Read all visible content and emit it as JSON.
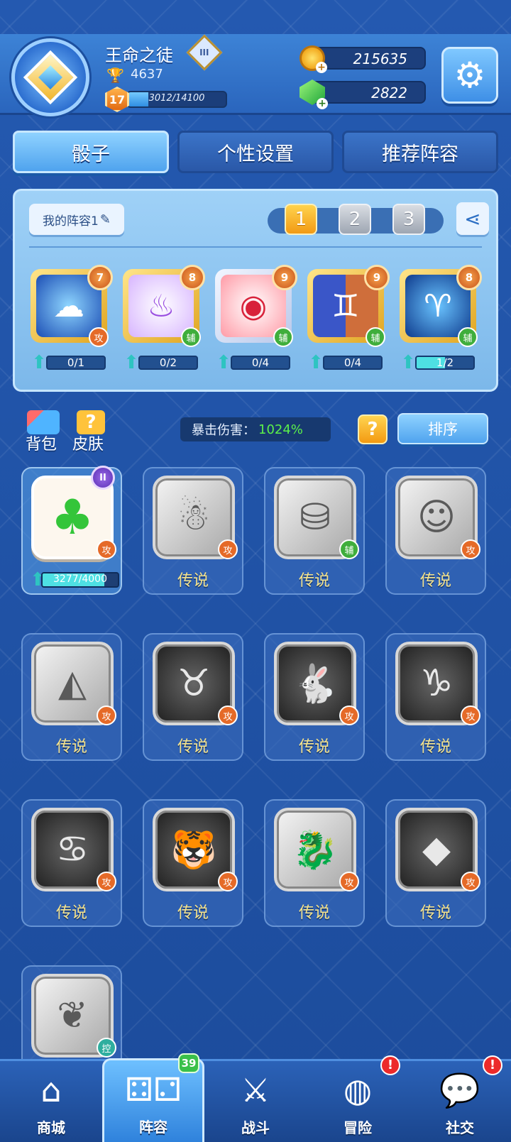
{
  "header": {
    "player_name": "王命之徒",
    "rank_badge": "III",
    "trophies": "4637",
    "level": "17",
    "xp_text": "3012/14100",
    "xp_fraction": 0.2136,
    "coins": "215635",
    "gems": "2822"
  },
  "tabs": [
    "骰子",
    "个性设置",
    "推荐阵容"
  ],
  "lineup": {
    "name": "我的阵容1",
    "slots": [
      "1",
      "2",
      "3"
    ],
    "active_slot": 0,
    "dice": [
      {
        "level": "7",
        "role": "攻",
        "progress": "0/1",
        "fraction": 0.0
      },
      {
        "level": "8",
        "role": "辅",
        "progress": "0/2",
        "fraction": 0.0
      },
      {
        "level": "9",
        "role": "辅",
        "progress": "0/4",
        "fraction": 0.0
      },
      {
        "level": "9",
        "role": "辅",
        "progress": "0/4",
        "fraction": 0.0
      },
      {
        "level": "8",
        "role": "辅",
        "progress": "1/2",
        "fraction": 0.5
      }
    ]
  },
  "toolbar": {
    "bag_label": "背包",
    "skin_label": "皮肤",
    "crit_label": "暴击伤害：",
    "crit_value": "1024%",
    "help_label": "?",
    "sort_label": "排序"
  },
  "collection": [
    {
      "role": "攻",
      "label": "",
      "owned": true,
      "badge": "II",
      "progress": "3277/4000",
      "fraction": 0.819
    },
    {
      "role": "攻",
      "label": "传说"
    },
    {
      "role": "辅",
      "label": "传说"
    },
    {
      "role": "攻",
      "label": "传说"
    },
    {
      "role": "攻",
      "label": "传说"
    },
    {
      "role": "攻",
      "label": "传说"
    },
    {
      "role": "攻",
      "label": "传说"
    },
    {
      "role": "攻",
      "label": "传说"
    },
    {
      "role": "攻",
      "label": "传说"
    },
    {
      "role": "攻",
      "label": "传说"
    },
    {
      "role": "攻",
      "label": "传说"
    },
    {
      "role": "攻",
      "label": "传说"
    },
    {
      "role": "控",
      "label": ""
    }
  ],
  "nav": [
    {
      "label": "商城",
      "icon": "shop-icon"
    },
    {
      "label": "阵容",
      "icon": "dice-icon",
      "badge": "39"
    },
    {
      "label": "战斗",
      "icon": "crossed-swords-icon"
    },
    {
      "label": "冒险",
      "icon": "planet-icon",
      "alert": "!"
    },
    {
      "label": "社交",
      "icon": "chat-bubbles-icon",
      "alert": "!"
    }
  ]
}
